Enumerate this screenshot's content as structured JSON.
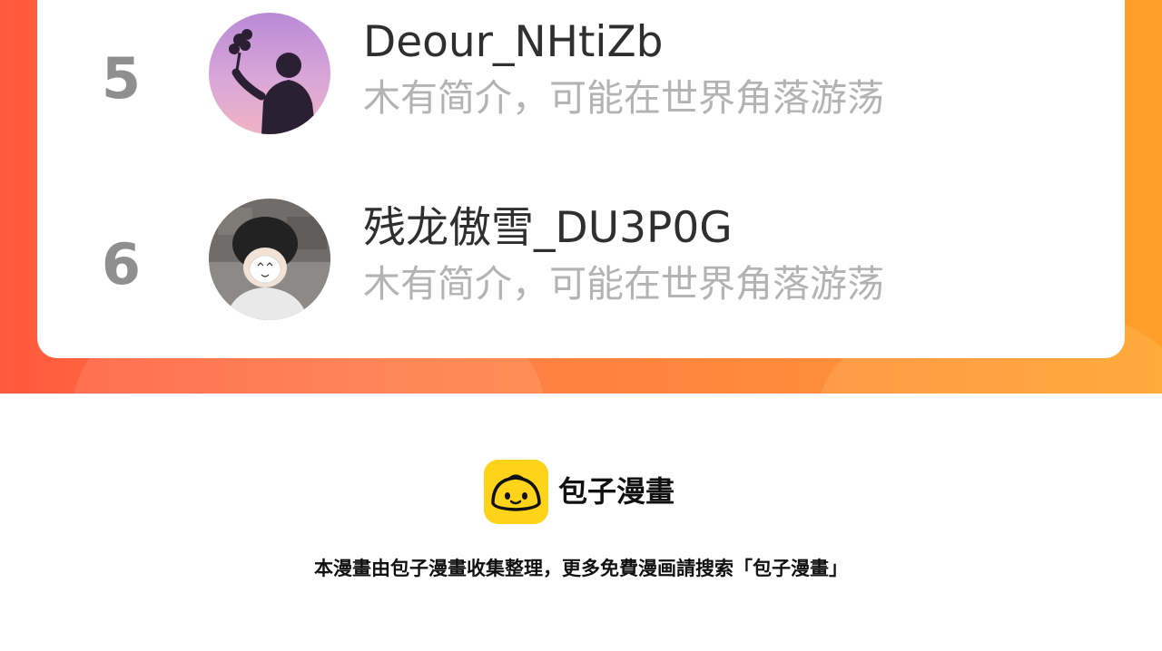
{
  "ranking": {
    "entries": [
      {
        "rank": "5",
        "name": "Deour_NHtiZb",
        "bio": "木有简介，可能在世界角落游荡",
        "avatar_icon": "person-silhouette-sunset-avatar"
      },
      {
        "rank": "6",
        "name": "残龙傲雪_DU3P0G",
        "bio": "木有简介，可能在世界角落游荡",
        "avatar_icon": "person-portrait-avatar"
      }
    ]
  },
  "footer": {
    "brand": "包子漫畫",
    "logo_icon": "bun-mascot-icon",
    "note": "本漫畫由包子漫畫收集整理，更多免費漫画請搜索「包子漫畫」"
  },
  "colors": {
    "banner_start": "#ff5a3c",
    "banner_end": "#ff9f2a",
    "logo_yellow": "#ffd31a",
    "rank_gray": "#8f8f8f",
    "bio_gray": "#b3b3b3"
  }
}
